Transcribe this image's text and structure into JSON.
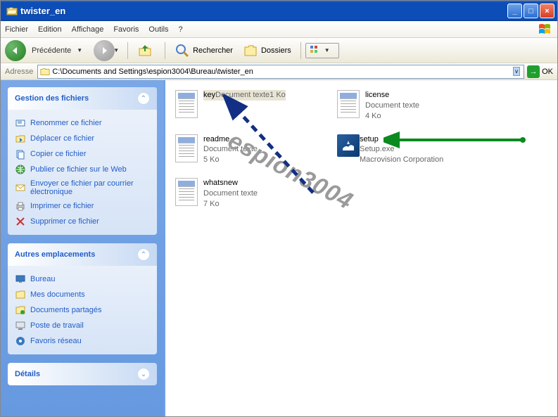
{
  "window": {
    "title": "twister_en"
  },
  "menu": {
    "items": [
      "Fichier",
      "Edition",
      "Affichage",
      "Favoris",
      "Outils",
      "?"
    ]
  },
  "toolbar": {
    "back": "Précédente",
    "search": "Rechercher",
    "folders": "Dossiers"
  },
  "address": {
    "label": "Adresse",
    "path": "C:\\Documents and Settings\\espion3004\\Bureau\\twister_en",
    "ok": "OK"
  },
  "sidebar": {
    "tasks": {
      "title": "Gestion des fichiers",
      "items": [
        {
          "icon": "rename",
          "label": "Renommer ce fichier"
        },
        {
          "icon": "move",
          "label": "Déplacer ce fichier"
        },
        {
          "icon": "copy",
          "label": "Copier ce fichier"
        },
        {
          "icon": "web",
          "label": "Publier ce fichier sur le Web"
        },
        {
          "icon": "mail",
          "label": "Envoyer ce fichier par courrier électronique"
        },
        {
          "icon": "print",
          "label": "Imprimer ce fichier"
        },
        {
          "icon": "delete",
          "label": "Supprimer ce fichier"
        }
      ]
    },
    "places": {
      "title": "Autres emplacements",
      "items": [
        {
          "icon": "desktop",
          "label": "Bureau"
        },
        {
          "icon": "mydocs",
          "label": "Mes documents"
        },
        {
          "icon": "shared",
          "label": "Documents partagés"
        },
        {
          "icon": "computer",
          "label": "Poste de travail"
        },
        {
          "icon": "network",
          "label": "Favoris réseau"
        }
      ]
    },
    "details": {
      "title": "Détails"
    }
  },
  "files": [
    {
      "name": "key",
      "type": "Document texte",
      "size": "1 Ko",
      "icon": "txt",
      "selected": true
    },
    {
      "name": "license",
      "type": "Document texte",
      "size": "4 Ko",
      "icon": "txt"
    },
    {
      "name": "readme",
      "type": "Document texte",
      "size": "5 Ko",
      "icon": "txt"
    },
    {
      "name": "setup",
      "type": "Setup.exe",
      "size": "Macrovision Corporation",
      "icon": "setup"
    },
    {
      "name": "whatsnew",
      "type": "Document texte",
      "size": "7 Ko",
      "icon": "txt"
    }
  ],
  "watermark": "espion3004"
}
